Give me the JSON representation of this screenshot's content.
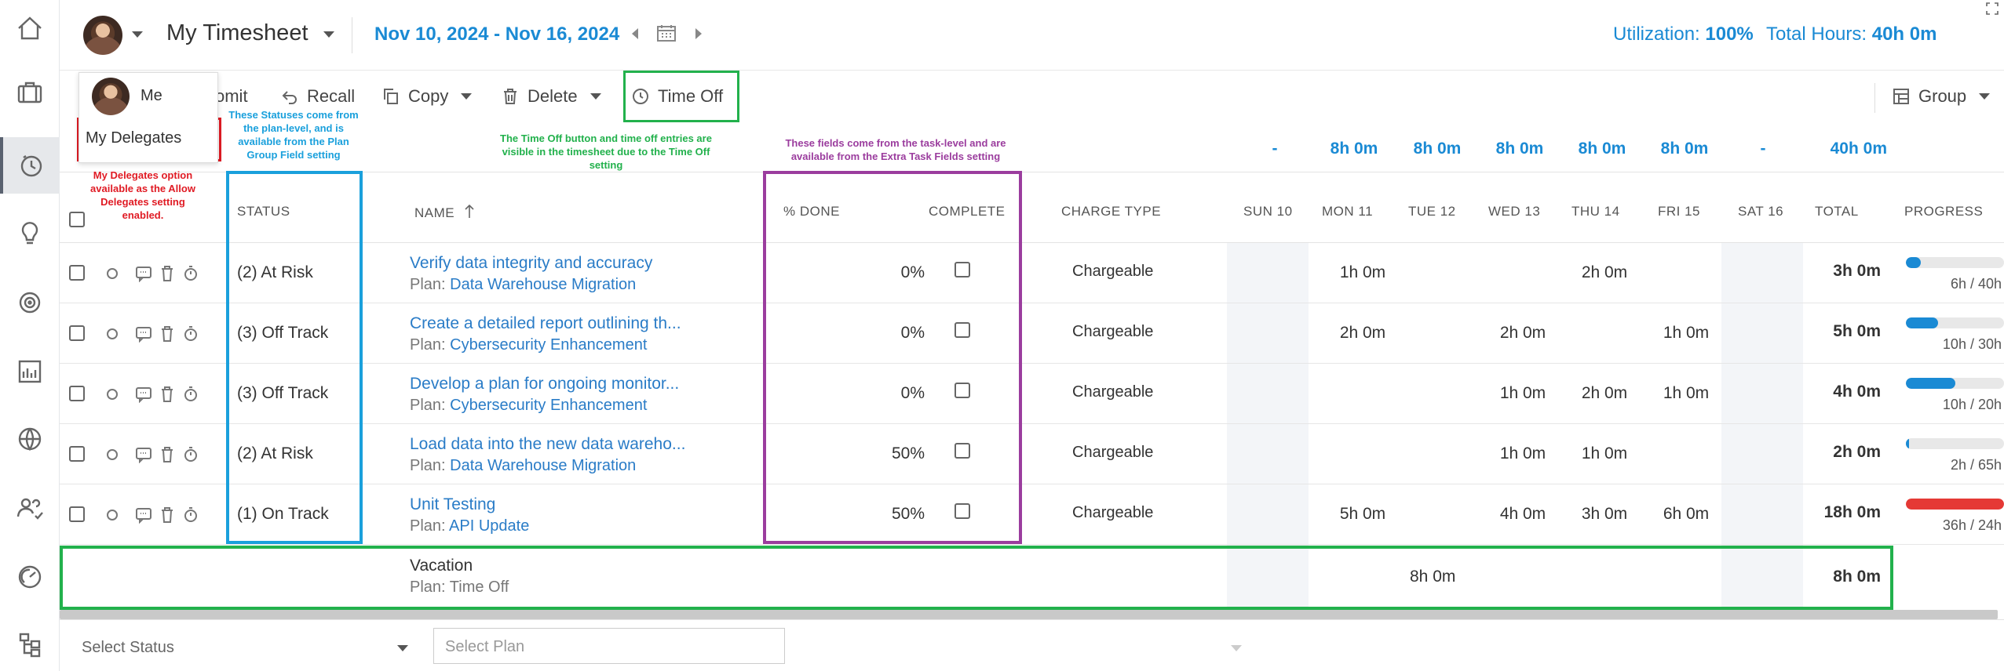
{
  "header": {
    "title": "My Timesheet",
    "date_range": "Nov 10, 2024 - Nov 16, 2024",
    "utilization_label": "Utilization:",
    "utilization_value": "100%",
    "total_hours_label": "Total Hours:",
    "total_hours_value": "40h 0m"
  },
  "user_menu": {
    "me_label": "Me",
    "delegates_label": "My Delegates"
  },
  "toolbar": {
    "submit_label": "omit",
    "recall_label": "Recall",
    "copy_label": "Copy",
    "delete_label": "Delete",
    "time_off_label": "Time Off",
    "group_label": "Group"
  },
  "annotations": {
    "statuses": "These Statuses come from the plan-level, and is available from the Plan Group Field setting",
    "time_off": "The Time Off button and time off entries are visible in the timesheet due to the Time Off setting",
    "extra_fields": "These fields come from the task-level and are available from the Extra Task Fields setting",
    "delegates": "My Delegates option available as the Allow Delegates setting enabled."
  },
  "totals": {
    "sun": "-",
    "mon": "8h 0m",
    "tue": "8h 0m",
    "wed": "8h 0m",
    "thu": "8h 0m",
    "fri": "8h 0m",
    "sat": "-",
    "total": "40h 0m"
  },
  "columns": {
    "status": "STATUS",
    "name": "NAME",
    "pct_done": "% DONE",
    "complete": "COMPLETE",
    "charge_type": "CHARGE TYPE",
    "sun": "SUN 10",
    "mon": "MON 11",
    "tue": "TUE 12",
    "wed": "WED 13",
    "thu": "THU 14",
    "fri": "FRI 15",
    "sat": "SAT 16",
    "total": "TOTAL",
    "progress": "PROGRESS"
  },
  "plan_prefix": "Plan:",
  "rows": [
    {
      "status": "(2) At Risk",
      "task": "Verify data integrity and accuracy",
      "plan": "Data Warehouse Migration",
      "pct": "0%",
      "charge": "Chargeable",
      "mon": "1h 0m",
      "tue": "",
      "wed": "",
      "thu": "2h 0m",
      "fri": "",
      "total": "3h 0m",
      "progress": "6h / 40h",
      "progress_fraction": 0.15,
      "progress_color": "#1a8ad4"
    },
    {
      "status": "(3) Off Track",
      "task": "Create a detailed report outlining th...",
      "plan": "Cybersecurity Enhancement",
      "pct": "0%",
      "charge": "Chargeable",
      "mon": "2h 0m",
      "tue": "",
      "wed": "2h 0m",
      "thu": "",
      "fri": "1h 0m",
      "total": "5h 0m",
      "progress": "10h / 30h",
      "progress_fraction": 0.33,
      "progress_color": "#1a8ad4"
    },
    {
      "status": "(3) Off Track",
      "task": "Develop a plan for ongoing monitor...",
      "plan": "Cybersecurity Enhancement",
      "pct": "0%",
      "charge": "Chargeable",
      "mon": "",
      "tue": "",
      "wed": "1h 0m",
      "thu": "2h 0m",
      "fri": "1h 0m",
      "total": "4h 0m",
      "progress": "10h / 20h",
      "progress_fraction": 0.5,
      "progress_color": "#1a8ad4"
    },
    {
      "status": "(2) At Risk",
      "task": "Load data into the new data wareho...",
      "plan": "Data Warehouse Migration",
      "pct": "50%",
      "charge": "Chargeable",
      "mon": "",
      "tue": "",
      "wed": "1h 0m",
      "thu": "1h 0m",
      "fri": "",
      "total": "2h 0m",
      "progress": "2h / 65h",
      "progress_fraction": 0.03,
      "progress_color": "#1a8ad4"
    },
    {
      "status": "(1) On Track",
      "task": "Unit Testing",
      "plan": "API Update",
      "pct": "50%",
      "charge": "Chargeable",
      "mon": "5h 0m",
      "tue": "",
      "wed": "4h 0m",
      "thu": "3h 0m",
      "fri": "6h 0m",
      "total": "18h 0m",
      "progress": "36h / 24h",
      "progress_fraction": 1.0,
      "progress_color": "#e53935"
    }
  ],
  "time_off_row": {
    "task": "Vacation",
    "plan": "Time Off",
    "tue": "8h 0m",
    "total": "8h 0m"
  },
  "footer": {
    "select_status": "Select Status",
    "select_plan": "Select Plan"
  }
}
